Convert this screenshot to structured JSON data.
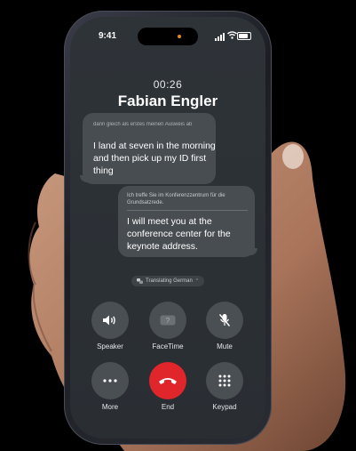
{
  "status": {
    "time": "9:41"
  },
  "call": {
    "duration": "00:26",
    "caller": "Fabian Engler"
  },
  "messages": [
    {
      "original": "dann gleich als erstes meinen Ausweis ab",
      "translation": "I land at seven in the morning and then pick up my ID first thing"
    },
    {
      "original": "Ich treffe Sie im Konferenzzentrum für die Grundsatzrede.",
      "translation": "I will meet you at the conference center for the keynote address."
    }
  ],
  "translating_label": "Translating German",
  "controls": {
    "speaker": "Speaker",
    "facetime": "FaceTime",
    "mute": "Mute",
    "more": "More",
    "end": "End",
    "keypad": "Keypad"
  },
  "colors": {
    "end_button": "#e0262b",
    "screen": "#2e3338",
    "bubble": "#484d52",
    "dynamic_island_indicator": "#e08a22"
  }
}
